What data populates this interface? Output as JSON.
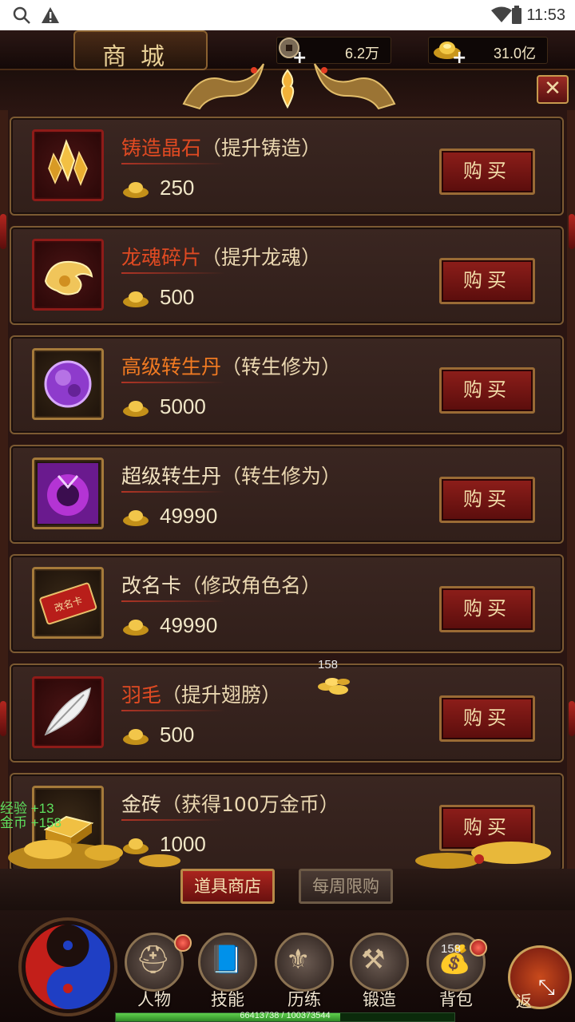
{
  "status_bar": {
    "time": "11:53",
    "search_icon": "search-icon",
    "warning_icon": "warning-icon",
    "wifi_icon": "wifi-icon",
    "battery_icon": "battery-icon"
  },
  "header": {
    "title": "商城",
    "copper_value": "6.2万",
    "gold_value": "31.0亿",
    "close_label": "✕"
  },
  "items": [
    {
      "name": "铸造晶石",
      "desc": "（提升铸造）",
      "price": "250",
      "buy": "购买",
      "name_color": "red",
      "icon": "crystal-icon",
      "frame": "red"
    },
    {
      "name": "龙魂碎片",
      "desc": "（提升龙魂）",
      "price": "500",
      "buy": "购买",
      "name_color": "red",
      "icon": "dragon-soul-icon",
      "frame": "red"
    },
    {
      "name": "高级转生丹",
      "desc": "（转生修为）",
      "price": "5000",
      "buy": "购买",
      "name_color": "orange",
      "icon": "purple-orb-icon",
      "frame": "gold"
    },
    {
      "name": "超级转生丹",
      "desc": "（转生修为）",
      "price": "49990",
      "buy": "购买",
      "name_color": "beige",
      "icon": "super-pill-icon",
      "frame": "gold"
    },
    {
      "name": "改名卡",
      "desc": "（修改角色名）",
      "price": "49990",
      "buy": "购买",
      "name_color": "beige",
      "icon": "rename-card-icon",
      "frame": "gold"
    },
    {
      "name": "羽毛",
      "desc": "（提升翅膀）",
      "price": "500",
      "buy": "购买",
      "name_color": "red",
      "icon": "feather-icon",
      "frame": "red"
    },
    {
      "name": "金砖",
      "desc": "（获得100万金币）",
      "price": "1000",
      "buy": "购买",
      "name_color": "beige",
      "icon": "gold-brick-icon",
      "frame": "gold"
    }
  ],
  "card_sign_text": "改名卡",
  "floating": {
    "coin_count": "158",
    "exp_text": "经验 +13",
    "gold_text": "金币 +158"
  },
  "tabs": {
    "props_shop": "道具商店",
    "weekly_limited": "每周限购"
  },
  "nav": {
    "character": "人物",
    "skills": "技能",
    "training": "历练",
    "forging": "锻造",
    "bag": "背包",
    "bag_badge": "158",
    "back": "返"
  },
  "xp": {
    "text": "66413738 / 100373544",
    "current": 66413738,
    "max": 100373544
  }
}
